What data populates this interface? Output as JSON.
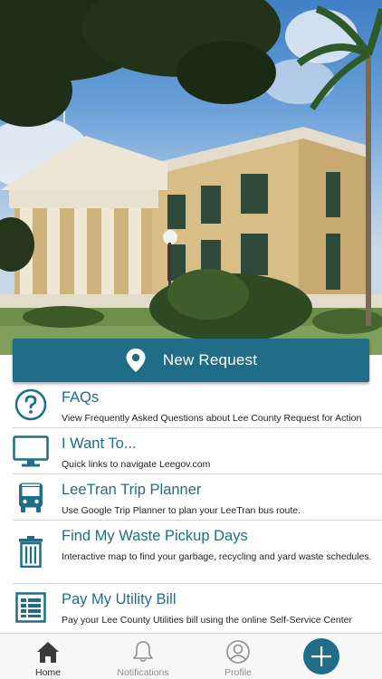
{
  "new_request": {
    "label": "New Request",
    "icon": "map-pin-icon"
  },
  "menu": {
    "items": [
      {
        "icon": "question-circle-icon",
        "title": "FAQs",
        "description": "View Frequently Asked Questions about Lee County Request for Action"
      },
      {
        "icon": "monitor-icon",
        "title": "I Want To...",
        "description": "Quick links to navigate Leegov.com"
      },
      {
        "icon": "bus-icon",
        "title": "LeeTran Trip Planner",
        "description": "Use Google Trip Planner to plan your LeeTran bus route."
      },
      {
        "icon": "trash-can-icon",
        "title": "Find My Waste Pickup Days",
        "description": "Interactive map to find your garbage, recycling and yard waste schedules."
      },
      {
        "icon": "bill-document-icon",
        "title": "Pay My Utility Bill",
        "description": "Pay your Lee County Utilities bill using the online Self-Service Center"
      }
    ]
  },
  "tabbar": {
    "home": "Home",
    "notifications": "Notifications",
    "profile": "Profile",
    "add_icon": "plus-icon"
  },
  "colors": {
    "accent": "#1f6d86",
    "tab_inactive": "#8e8e8e"
  }
}
